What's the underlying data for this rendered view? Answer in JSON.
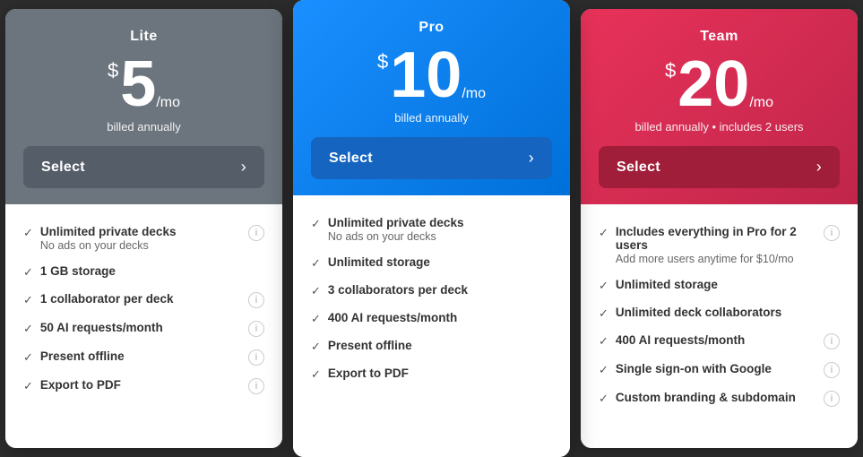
{
  "plans": [
    {
      "id": "lite",
      "name": "Lite",
      "currency": "$",
      "price": "5",
      "period": "/mo",
      "billing": "billed annually",
      "select_label": "Select",
      "header_class": "lite-header",
      "btn_class": "lite-btn",
      "features": [
        {
          "title": "Unlimited private decks",
          "sub": "No ads on your decks",
          "has_info": true
        },
        {
          "title": "1 GB storage",
          "sub": "",
          "has_info": false
        },
        {
          "title": "1 collaborator per deck",
          "sub": "",
          "has_info": true
        },
        {
          "title": "50 AI requests/month",
          "sub": "",
          "has_info": true
        },
        {
          "title": "Present offline",
          "sub": "",
          "has_info": true
        },
        {
          "title": "Export to PDF",
          "sub": "",
          "has_info": true
        }
      ]
    },
    {
      "id": "pro",
      "name": "Pro",
      "currency": "$",
      "price": "10",
      "period": "/mo",
      "billing": "billed annually",
      "select_label": "Select",
      "header_class": "pro-header",
      "btn_class": "pro-btn",
      "features": [
        {
          "title": "Unlimited private decks",
          "sub": "No ads on your decks",
          "has_info": false
        },
        {
          "title": "Unlimited storage",
          "sub": "",
          "has_info": false
        },
        {
          "title": "3 collaborators per deck",
          "sub": "",
          "has_info": false
        },
        {
          "title": "400 AI requests/month",
          "sub": "",
          "has_info": false
        },
        {
          "title": "Present offline",
          "sub": "",
          "has_info": false
        },
        {
          "title": "Export to PDF",
          "sub": "",
          "has_info": false
        }
      ]
    },
    {
      "id": "team",
      "name": "Team",
      "currency": "$",
      "price": "20",
      "period": "/mo",
      "billing": "billed annually • includes 2 users",
      "select_label": "Select",
      "header_class": "team-header",
      "btn_class": "team-btn",
      "features": [
        {
          "title": "Includes everything in Pro for 2 users",
          "sub": "Add more users anytime for $10/mo",
          "has_info": true
        },
        {
          "title": "Unlimited storage",
          "sub": "",
          "has_info": false
        },
        {
          "title": "Unlimited deck collaborators",
          "sub": "",
          "has_info": false
        },
        {
          "title": "400 AI requests/month",
          "sub": "",
          "has_info": true
        },
        {
          "title": "Single sign-on with Google",
          "sub": "",
          "has_info": true
        },
        {
          "title": "Custom branding & subdomain",
          "sub": "",
          "has_info": true
        }
      ]
    }
  ]
}
